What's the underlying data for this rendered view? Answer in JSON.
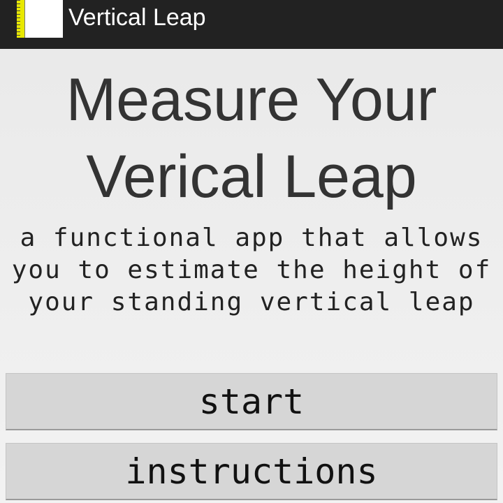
{
  "action_bar": {
    "title": "Vertical Leap",
    "icon": "ruler-app-icon"
  },
  "main": {
    "headline_line1": "Measure Your",
    "headline_line2": "Verical Leap",
    "subtitle_line1": "a functional app that allows",
    "subtitle_line2": "you to estimate the height of",
    "subtitle_line3": "your standing vertical leap"
  },
  "buttons": {
    "start_label": "start",
    "instructions_label": "instructions"
  },
  "colors": {
    "action_bar_bg": "#222222",
    "text_dark": "#333333",
    "button_bg": "#d6d6d6",
    "icon_accent": "#e8e800"
  }
}
